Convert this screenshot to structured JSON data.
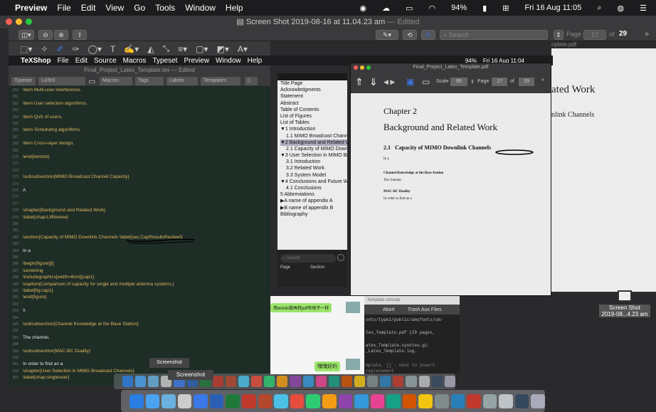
{
  "menubar": {
    "apple": "",
    "app": "Preview",
    "items": [
      "File",
      "Edit",
      "View",
      "Go",
      "Tools",
      "Window",
      "Help"
    ],
    "battery": "94%",
    "clock": "Fri 16 Aug 11:05"
  },
  "preview": {
    "title": "Screen Shot 2019-08-16 at 11.04.23 am",
    "edited": "— Edited",
    "search_placeholder": "Search",
    "page_label": "Page",
    "page_value": "17",
    "of_label": "of",
    "page_total": "29",
    "right_file": "nplate.pdf"
  },
  "right_doc": {
    "line1": "ated Work",
    "line2": "nlink Channels"
  },
  "texshop_menubar": {
    "app": "TeXShop",
    "items": [
      "File",
      "Edit",
      "Source",
      "Macros",
      "Typeset",
      "Preview",
      "Window",
      "Help"
    ],
    "battery": "94%",
    "clock": "Fri 16 Aug 11:04"
  },
  "tex_window": {
    "title": "Final_Project_Latex_Template.tex",
    "edited": "— Edited",
    "typeset": "Typeset",
    "engine": "LaTeX",
    "macros": "Macros",
    "tags": "Tags",
    "labels": "Labels",
    "templates": "Templates"
  },
  "editor_lines": [
    {
      "n": "260",
      "t": "\\item Multi-user interference.",
      "c": true
    },
    {
      "n": "261",
      "t": "",
      "c": false
    },
    {
      "n": "262",
      "t": "\\item User selection algorithms.",
      "c": true
    },
    {
      "n": "263",
      "t": "",
      "c": false
    },
    {
      "n": "264",
      "t": "\\item QoS of users.",
      "c": true
    },
    {
      "n": "265",
      "t": "",
      "c": false
    },
    {
      "n": "266",
      "t": "\\item Scheduling algorithms.",
      "c": true
    },
    {
      "n": "267",
      "t": "",
      "c": false
    },
    {
      "n": "268",
      "t": "\\item Cross-layer design.",
      "c": true
    },
    {
      "n": "269",
      "t": "",
      "c": false
    },
    {
      "n": "270",
      "t": "\\end{itemize}",
      "c": true
    },
    {
      "n": "271",
      "t": "",
      "c": false
    },
    {
      "n": "272",
      "t": "",
      "c": false
    },
    {
      "n": "273",
      "t": "\\subsubsection{MIMO Broadcast Channel Capacity}",
      "c": true
    },
    {
      "n": "274",
      "t": "",
      "c": false
    },
    {
      "n": "275",
      "t": "A",
      "c": false
    },
    {
      "n": "276",
      "t": "",
      "c": false
    },
    {
      "n": "277",
      "t": "",
      "c": false
    },
    {
      "n": "278",
      "t": "\\chapter{Background and Related Work}",
      "c": true
    },
    {
      "n": "279",
      "t": "\\label{chap:LitReview}",
      "c": true
    },
    {
      "n": "280",
      "t": "",
      "c": false
    },
    {
      "n": "281",
      "t": "",
      "c": false
    },
    {
      "n": "282",
      "t": "\\section{Capacity of MIMO Downlink Channels \\label{sec:CapResultsReview}}",
      "c": true
    },
    {
      "n": "283",
      "t": "",
      "c": false
    },
    {
      "n": "284",
      "t": "In a",
      "c": false
    },
    {
      "n": "285",
      "t": "",
      "c": false
    },
    {
      "n": "286",
      "t": "\\begin{figure}[t]",
      "c": true
    },
    {
      "n": "287",
      "t": "\\centering",
      "c": true
    },
    {
      "n": "288",
      "t": "\\includegraphics[width=8cm]{cap1}",
      "c": true
    },
    {
      "n": "289",
      "t": "\\caption{Comparison of capacity for single and multiple antenna systems.}",
      "c": true
    },
    {
      "n": "290",
      "t": "\\label{fig:cap1}",
      "c": true
    },
    {
      "n": "291",
      "t": "\\end{figure}",
      "c": true
    },
    {
      "n": "292",
      "t": "",
      "c": false
    },
    {
      "n": "293",
      "t": "\\\\",
      "c": false
    },
    {
      "n": "294",
      "t": "",
      "c": false
    },
    {
      "n": "295",
      "t": "\\subsubsection{Channel Knowledge at the Base Station}",
      "c": true
    },
    {
      "n": "296",
      "t": "",
      "c": false
    },
    {
      "n": "297",
      "t": "The channel.",
      "c": false
    },
    {
      "n": "298",
      "t": "",
      "c": false
    },
    {
      "n": "299",
      "t": "\\subsubsection{MAC-BC Duality}",
      "c": true
    },
    {
      "n": "300",
      "t": "",
      "c": false
    },
    {
      "n": "301",
      "t": "In order to find an a",
      "c": false
    },
    {
      "n": "302",
      "t": "\\chapter{User Selection in MIMO Broadcast Channels}",
      "c": true
    },
    {
      "n": "303",
      "t": "\\label{chap:singleuser}",
      "c": true
    }
  ],
  "toc": {
    "items": [
      {
        "t": "Title Page",
        "i": false,
        "s": false
      },
      {
        "t": "Acknowledgments",
        "i": false,
        "s": false
      },
      {
        "t": "Statement",
        "i": false,
        "s": false
      },
      {
        "t": "Abstract",
        "i": false,
        "s": false
      },
      {
        "t": "Table of Contents",
        "i": false,
        "s": false
      },
      {
        "t": "List of Figures",
        "i": false,
        "s": false
      },
      {
        "t": "List of Tables",
        "i": false,
        "s": false
      },
      {
        "t": "▼1 Introduction",
        "i": false,
        "s": false
      },
      {
        "t": "1.1 MIMO Broadcast Chann",
        "i": true,
        "s": false
      },
      {
        "t": "▼2 Background and Related Wo",
        "i": false,
        "s": true
      },
      {
        "t": "2.1 Capacity of MIMO Down",
        "i": true,
        "s": false
      },
      {
        "t": "▼3 User Selection in MIMO Bro",
        "i": false,
        "s": false
      },
      {
        "t": "3.1 Introduction",
        "i": true,
        "s": false
      },
      {
        "t": "3.2 Related Work",
        "i": true,
        "s": false
      },
      {
        "t": "3.3 System Model",
        "i": true,
        "s": false
      },
      {
        "t": "▼4 Conclusions and Future Wo",
        "i": false,
        "s": false
      },
      {
        "t": "4.1 Conclusions",
        "i": true,
        "s": false
      },
      {
        "t": "5 Abbreviations",
        "i": false,
        "s": false
      },
      {
        "t": "▶A name of appendix A",
        "i": false,
        "s": false
      },
      {
        "t": "▶B name of appendix B",
        "i": false,
        "s": false
      },
      {
        "t": "Bibliography",
        "i": false,
        "s": false
      }
    ],
    "search_placeholder": "Search",
    "col_page": "Page",
    "col_section": "Section"
  },
  "pdf": {
    "title": "Final_Project_Latex_Template.pdf",
    "scale_label": "Scale",
    "scale_value": "89",
    "page_label": "Page",
    "page_value": "17",
    "of_label": "of",
    "page_total": "29",
    "chapter": "Chapter 2",
    "chapter_title": "Background and Related Work",
    "section_num": "2.1",
    "section_title": "Capacity of MIMO Downlink Channels",
    "text1": "In a",
    "sub1": "Channel Knowledge at the Base Station",
    "text2": "The channel.",
    "sub2": "MAC-BC Duality",
    "text3": "In order to find an a"
  },
  "console": {
    "title": "Template console",
    "abort": "Abort",
    "trash": "Trash Aux Files",
    "l1": "onts/type1/public/amsfonts/cm/",
    "l2": "tex_Template.pdf (29 pages,",
    "l3": "atex_Template.synctex.gz.",
    "l4": "_Latex_Template.log.",
    "l5": "mplate, [] - next to insert replacement"
  },
  "chat": {
    "msg1": "用words做再转pdf有啥不一样",
    "msg2": "嘿嘿好的"
  },
  "thumb": {
    "label1": "Screen Shot",
    "label2": "2019-08...4.23 am"
  },
  "tooltips": {
    "screenshot": "Screenshot",
    "screenshot2": "Screenshot"
  },
  "colors": {
    "accent": "#3b78e7",
    "editor_bg": "#1e2d26",
    "command": "#e0b860",
    "chat_bubble": "#9be46b"
  }
}
